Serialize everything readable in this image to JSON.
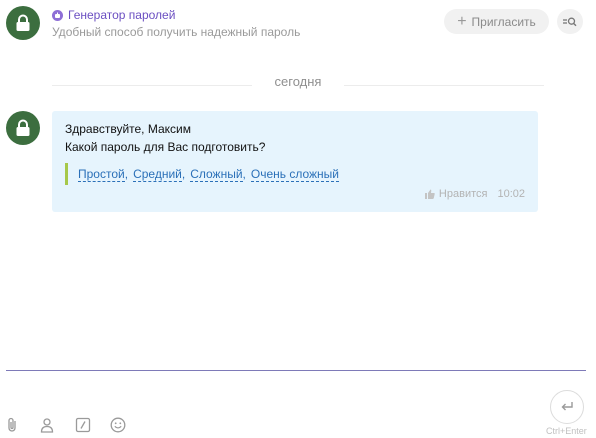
{
  "header": {
    "title": "Генератор паролей",
    "subtitle": "Удобный способ получить надежный пароль",
    "invite_label": "Пригласить"
  },
  "chat": {
    "date_separator": "сегодня",
    "message": {
      "line1": "Здравствуйте, Максим",
      "line2": "Какой пароль для Вас подготовить?",
      "options": [
        "Простой",
        "Средний",
        "Сложный",
        "Очень сложный"
      ],
      "separator": ",",
      "like_label": "Нравится",
      "time": "10:02"
    }
  },
  "composer": {
    "send_hint": "Ctrl+Enter",
    "tools": [
      "paperclip-icon",
      "contact-icon",
      "slash-command-icon",
      "smiley-icon"
    ]
  },
  "colors": {
    "avatar": "#3c6e3f",
    "title": "#6b4fc2",
    "bubble": "#e6f4fd",
    "option_link": "#2b70b8",
    "option_bar": "#a6c84a",
    "input_line": "#7e7ab8"
  }
}
